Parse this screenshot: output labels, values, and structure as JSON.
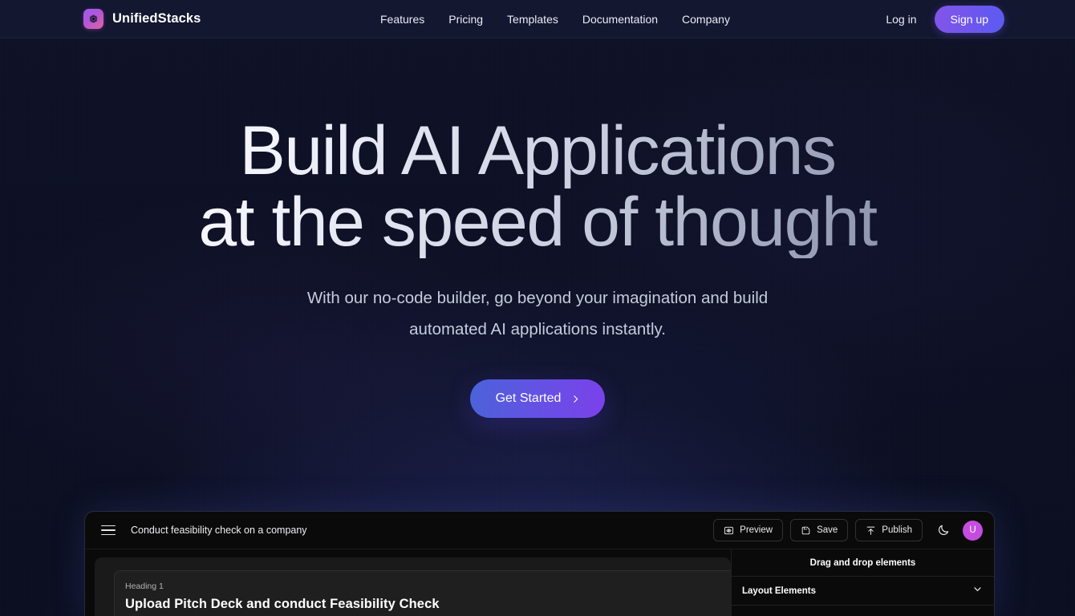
{
  "brand": {
    "name": "UnifiedStacks",
    "icon": "cube-logo-icon",
    "accent": "#b455d8"
  },
  "nav": {
    "links": [
      {
        "label": "Features"
      },
      {
        "label": "Pricing"
      },
      {
        "label": "Templates"
      },
      {
        "label": "Documentation"
      },
      {
        "label": "Company"
      }
    ],
    "login_label": "Log in",
    "signup_label": "Sign up"
  },
  "hero": {
    "title_line1": "Build AI Applications",
    "title_line2": "at the speed of thought",
    "sub_line1": "With our no-code builder, go beyond your imagination and build",
    "sub_line2": "automated AI applications instantly.",
    "cta_label": "Get Started",
    "cta_icon": "chevron-right-icon"
  },
  "mockup": {
    "menu_icon": "hamburger-menu-icon",
    "doc_title": "Conduct feasibility check on a company",
    "actions": [
      {
        "label": "Preview",
        "icon": "eye-in-frame-icon"
      },
      {
        "label": "Save",
        "icon": "save-disk-icon"
      },
      {
        "label": "Publish",
        "icon": "upload-arrow-icon"
      }
    ],
    "theme_toggle_icon": "moon-icon",
    "avatar_initial": "U",
    "avatar_color": "#c44de0",
    "canvas": {
      "block_label": "Heading 1",
      "block_heading": "Upload Pitch Deck and conduct Feasibility Check"
    },
    "panel": {
      "header": "Drag and drop elements",
      "sections": [
        {
          "label": "Layout Elements",
          "icon": "chevron-down-icon"
        }
      ]
    }
  }
}
